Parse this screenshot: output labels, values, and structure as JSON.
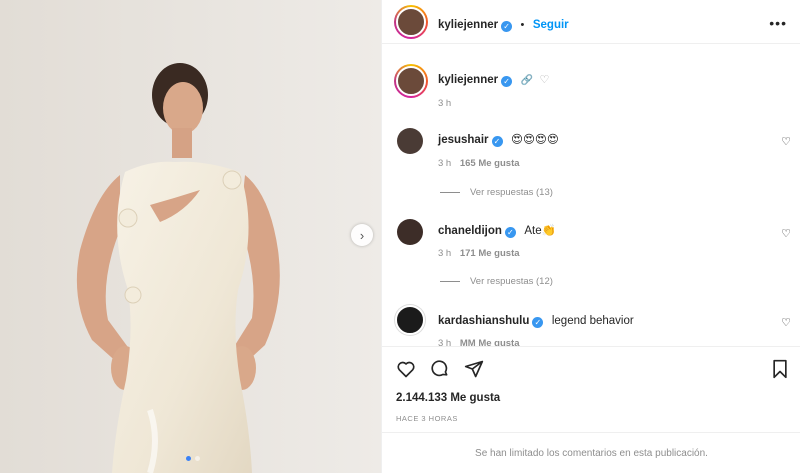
{
  "post": {
    "author": "kyliejenner",
    "follow_label": "Seguir",
    "more_icon": "more-horizontal-icon",
    "caption_time": "3 h",
    "likes": "2.144.133 Me gusta",
    "posted_ago": "HACE 3 HORAS",
    "comments_limited": "Se han limitado los comentarios en esta publicación."
  },
  "comments": [
    {
      "username": "jesushair",
      "text": "😍😍😍😍",
      "time": "3 h",
      "likes": "165 Me gusta",
      "replies": "Ver respuestas (13)"
    },
    {
      "username": "chaneldijon",
      "text": "Ate👏",
      "time": "3 h",
      "likes": "171 Me gusta",
      "replies": "Ver respuestas (12)"
    },
    {
      "username": "kardashianshulu",
      "text": "legend behavior",
      "time": "3 h",
      "likes": "MM Me gusta"
    }
  ],
  "carousel": {
    "current": 1,
    "total": 2
  },
  "colors": {
    "link": "#0095f6",
    "verified": "#3897f0",
    "muted": "#8e8e8e",
    "text": "#262626"
  }
}
